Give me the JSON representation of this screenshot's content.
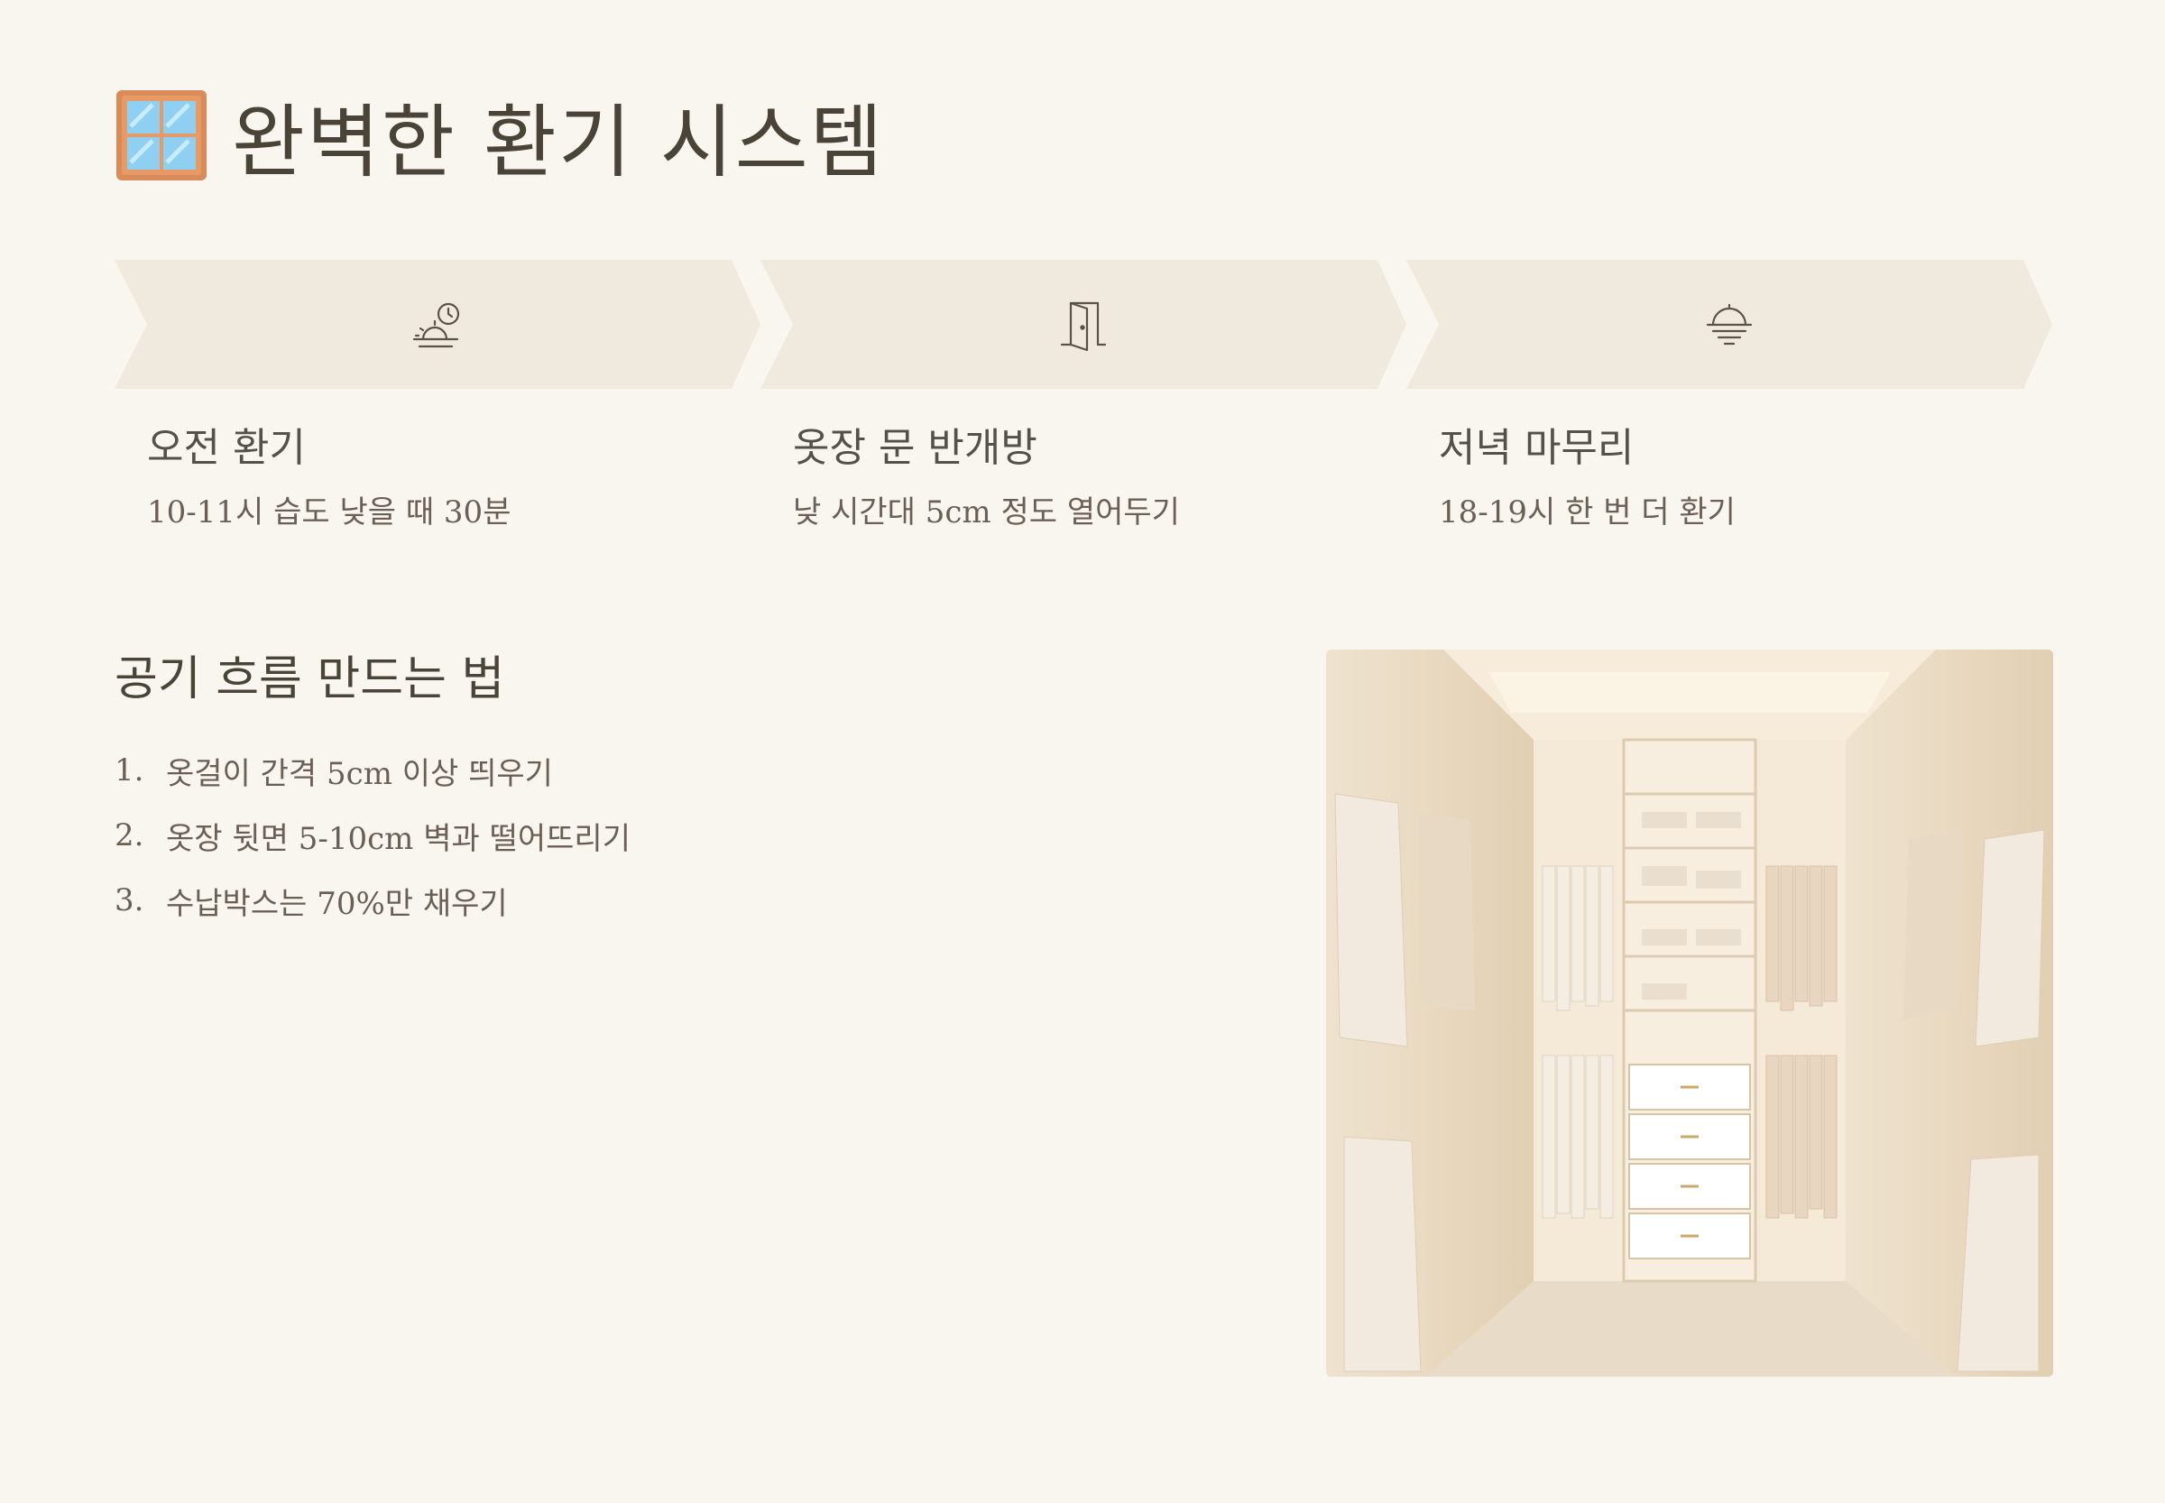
{
  "header": {
    "icon": "window-icon",
    "title": "완벽한 환기 시스템"
  },
  "steps": [
    {
      "icon": "sunrise-clock-icon",
      "title": "오전 환기",
      "desc": "10-11시 습도 낮을 때 30분"
    },
    {
      "icon": "door-icon",
      "title": "옷장 문 반개방",
      "desc": "낮 시간대 5cm 정도 열어두기"
    },
    {
      "icon": "sunset-icon",
      "title": "저녁 마무리",
      "desc": "18-19시 한 번 더 환기"
    }
  ],
  "airflow": {
    "title": "공기 흐름 만드는 법",
    "items": [
      {
        "num": "1.",
        "text": "옷걸이 간격 5cm 이상 띄우기"
      },
      {
        "num": "2.",
        "text": "옷장 뒷면 5-10cm 벽과 떨어뜨리기"
      },
      {
        "num": "3.",
        "text": "수납박스는 70%만 채우기"
      }
    ]
  },
  "photo": {
    "subject": "walk-in-closet-photo"
  },
  "colors": {
    "background": "#f9f6f0",
    "chevron": "#f0e9de",
    "heading": "#4a4438",
    "body_text": "#6b5f55"
  }
}
